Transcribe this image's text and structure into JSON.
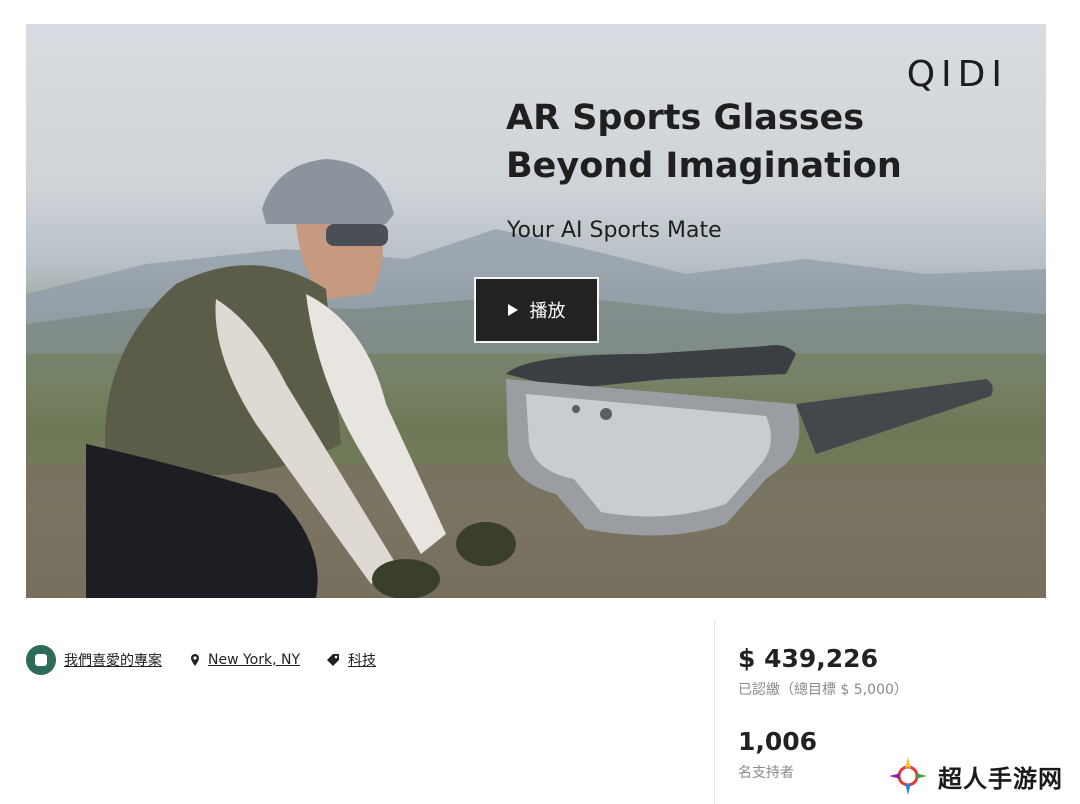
{
  "hero": {
    "brand": "QIDI",
    "headline_line1": "AR Sports Glasses",
    "headline_line2": "Beyond Imagination",
    "subline": "Your AI Sports Mate",
    "play_label": "播放"
  },
  "meta": {
    "favorite_label": "我們喜愛的專案",
    "location_label": "New York, NY",
    "category_label": "科技"
  },
  "stats": {
    "amount": "$ 439,226",
    "amount_sub": "已認繳（總目標 $ 5,000）",
    "backers": "1,006",
    "backers_sub": "名支持者"
  },
  "watermark": {
    "text": "超人手游网"
  },
  "colors": {
    "badge": "#2e6b5a",
    "play_bg": "#222222"
  }
}
